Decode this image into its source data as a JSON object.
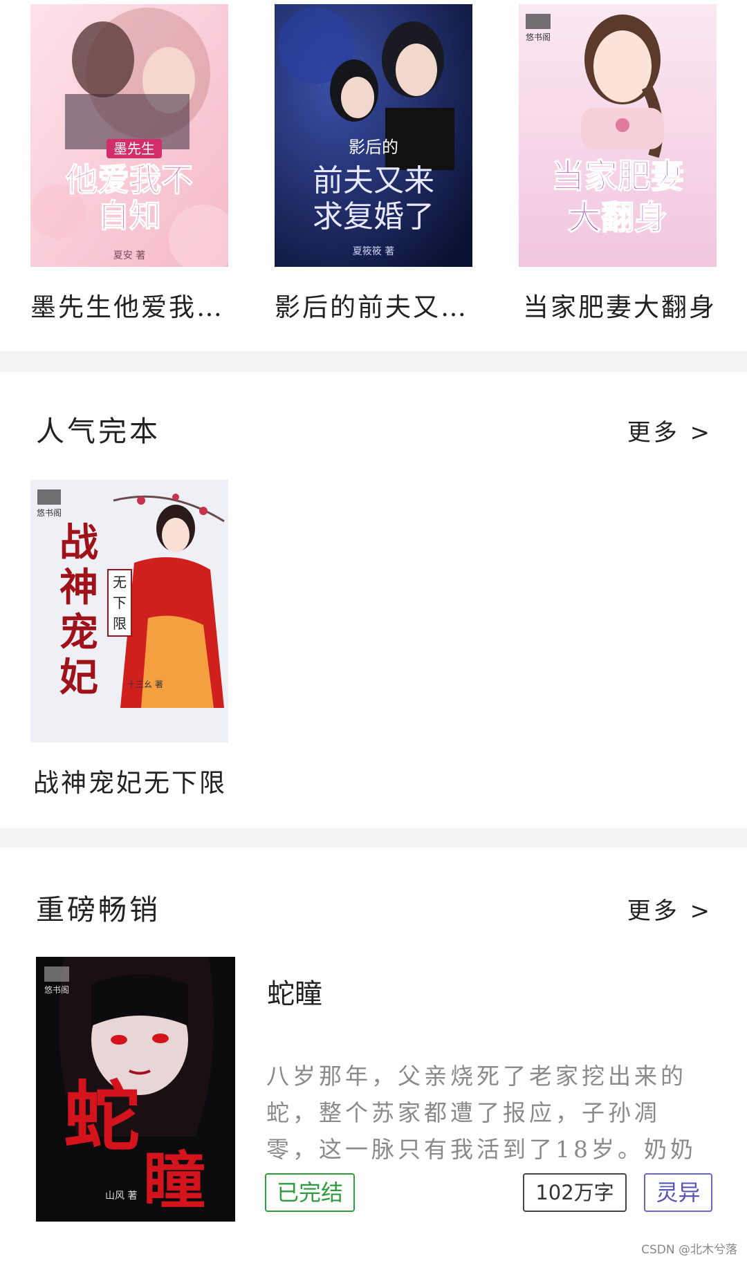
{
  "top_row": {
    "books": [
      {
        "title": "墨先生他爱我…",
        "cover": {
          "series": "墨先生",
          "main": "他爱我不自知",
          "author": "夏安 著",
          "palette": [
            "#f8c9d4",
            "#fbe3e8",
            "#d83a86"
          ]
        }
      },
      {
        "title": "影后的前夫又…",
        "cover": {
          "series": "影后的",
          "main": "前夫又来求复婚了",
          "author": "夏筱筱 著",
          "palette": [
            "#101a3a",
            "#2a3a7a",
            "#e8e8ff"
          ]
        }
      },
      {
        "title": "当家肥妻大翻身",
        "cover": {
          "series": "",
          "main": "当家肥妻大翻身",
          "author": "",
          "publisher": "悠书阁",
          "palette": [
            "#f4cfe4",
            "#fbe8f2",
            "#b21fbf"
          ]
        }
      }
    ]
  },
  "popular_complete": {
    "title": "人气完本",
    "more_label": "更多 >",
    "books": [
      {
        "title": "战神宠妃无下限",
        "cover": {
          "main": "战神宠妃",
          "sub": "无下限",
          "author": "十三幺 著",
          "publisher": "悠书阁",
          "palette": [
            "#eef0f6",
            "#d8dcea",
            "#a0121a"
          ]
        }
      }
    ]
  },
  "bestseller": {
    "title": "重磅畅销",
    "more_label": "更多 >",
    "book": {
      "title": "蛇瞳",
      "synopsis": "八岁那年，父亲烧死了老家挖出来的蛇，整个苏家都遭了报应，子孙凋零，这一脉只有我活到了18岁。奶奶带我问神婆我该",
      "status": "已完结",
      "word_count": "102万字",
      "genre": "灵异",
      "cover": {
        "main": "蛇瞳",
        "author": "山风 著",
        "publisher": "悠书阁",
        "palette": [
          "#0b0b0e",
          "#2a1a22",
          "#d4141c"
        ]
      },
      "colors": {
        "status": "#2e9b3e",
        "genre": "#6a63c9",
        "synopsis": "#8a8a8a"
      }
    }
  },
  "watermark": "CSDN @北木兮落"
}
